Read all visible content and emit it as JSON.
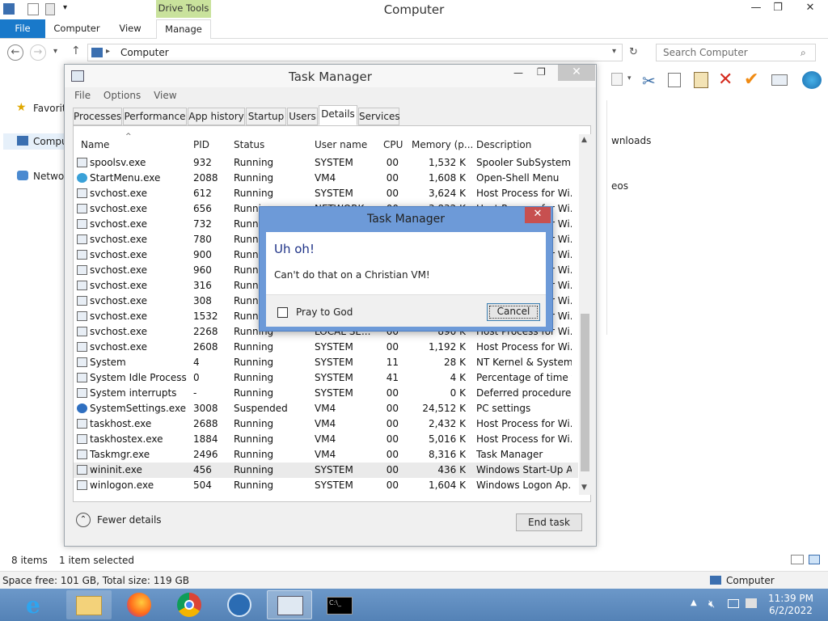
{
  "explorer": {
    "title": "Computer",
    "context_tab": "Drive Tools",
    "tabs": [
      "File",
      "Computer",
      "View",
      "Manage"
    ],
    "address": "Computer",
    "search_placeholder": "Search Computer",
    "nav": [
      "Favorit",
      "Compu",
      "Netwo"
    ],
    "right_items": [
      "wnloads",
      "eos"
    ],
    "status_items": "8 items",
    "status_selected": "1 item selected",
    "space": "Space free: 101 GB, Total size: 119 GB",
    "info_right": "Computer"
  },
  "taskmgr": {
    "title": "Task Manager",
    "menu": [
      "File",
      "Options",
      "View"
    ],
    "tabs": [
      "Processes",
      "Performance",
      "App history",
      "Startup",
      "Users",
      "Details",
      "Services"
    ],
    "columns": [
      "Name",
      "PID",
      "Status",
      "User name",
      "CPU",
      "Memory (p...",
      "Description"
    ],
    "rows": [
      [
        "spoolsv.exe",
        "932",
        "Running",
        "SYSTEM",
        "00",
        "1,532 K",
        "Spooler SubSystem ..."
      ],
      [
        "StartMenu.exe",
        "2088",
        "Running",
        "VM4",
        "00",
        "1,608 K",
        "Open-Shell Menu"
      ],
      [
        "svchost.exe",
        "612",
        "Running",
        "SYSTEM",
        "00",
        "3,624 K",
        "Host Process for Wi..."
      ],
      [
        "svchost.exe",
        "656",
        "Runni",
        "NETWORK",
        "00",
        "3,832 K",
        "Host Process for Wi..."
      ],
      [
        "svchost.exe",
        "732",
        "Runni",
        "",
        "",
        "",
        "Host Process for Wi..."
      ],
      [
        "svchost.exe",
        "780",
        "Runni",
        "",
        "",
        "",
        "Host Process for Wi..."
      ],
      [
        "svchost.exe",
        "900",
        "Runni",
        "",
        "",
        "",
        "Host Process for Wi..."
      ],
      [
        "svchost.exe",
        "960",
        "Runni",
        "",
        "",
        "",
        "Host Process for Wi..."
      ],
      [
        "svchost.exe",
        "316",
        "Runni",
        "",
        "",
        "",
        "Host Process for Wi..."
      ],
      [
        "svchost.exe",
        "308",
        "Runni",
        "",
        "",
        "",
        "Host Process for Wi..."
      ],
      [
        "svchost.exe",
        "1532",
        "Runni",
        "",
        "",
        "",
        "Host Process for Wi..."
      ],
      [
        "svchost.exe",
        "2268",
        "Running",
        "LOCAL SE...",
        "00",
        "890 K",
        "Host Process for Wi..."
      ],
      [
        "svchost.exe",
        "2608",
        "Running",
        "SYSTEM",
        "00",
        "1,192 K",
        "Host Process for Wi..."
      ],
      [
        "System",
        "4",
        "Running",
        "SYSTEM",
        "11",
        "28 K",
        "NT Kernel & System"
      ],
      [
        "System Idle Process",
        "0",
        "Running",
        "SYSTEM",
        "41",
        "4 K",
        "Percentage of time t..."
      ],
      [
        "System interrupts",
        "-",
        "Running",
        "SYSTEM",
        "00",
        "0 K",
        "Deferred procedure ..."
      ],
      [
        "SystemSettings.exe",
        "3008",
        "Suspended",
        "VM4",
        "00",
        "24,512 K",
        "PC settings"
      ],
      [
        "taskhost.exe",
        "2688",
        "Running",
        "VM4",
        "00",
        "2,432 K",
        "Host Process for Wi..."
      ],
      [
        "taskhostex.exe",
        "1884",
        "Running",
        "VM4",
        "00",
        "5,016 K",
        "Host Process for Wi..."
      ],
      [
        "Taskmgr.exe",
        "2496",
        "Running",
        "VM4",
        "00",
        "8,316 K",
        "Task Manager"
      ],
      [
        "wininit.exe",
        "456",
        "Running",
        "SYSTEM",
        "00",
        "436 K",
        "Windows Start-Up A..."
      ],
      [
        "winlogon.exe",
        "504",
        "Running",
        "SYSTEM",
        "00",
        "1,604 K",
        "Windows Logon Ap..."
      ]
    ],
    "fewer_details": "Fewer details",
    "end_task": "End task"
  },
  "dialog": {
    "title": "Task Manager",
    "heading": "Uh oh!",
    "message": "Can't do that on a Christian VM!",
    "checkbox_label": "Pray to God",
    "cancel": "Cancel"
  },
  "clock": {
    "time": "11:39 PM",
    "date": "6/2/2022"
  }
}
